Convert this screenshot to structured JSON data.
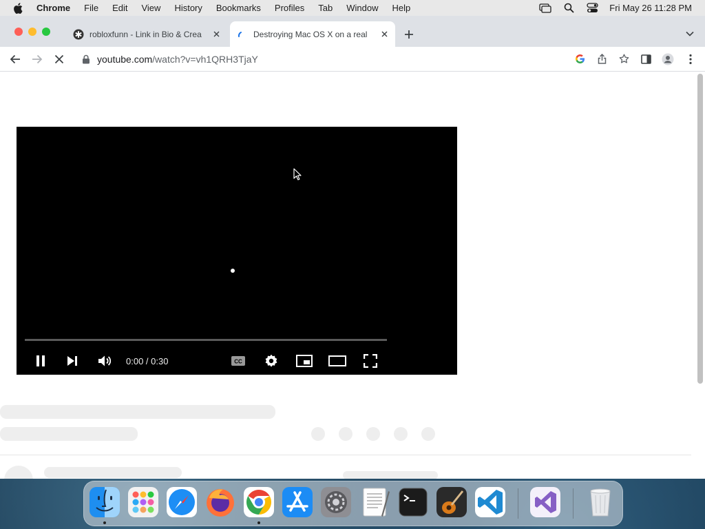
{
  "menubar": {
    "app_name": "Chrome",
    "items": [
      "File",
      "Edit",
      "View",
      "History",
      "Bookmarks",
      "Profiles",
      "Tab",
      "Window",
      "Help"
    ],
    "clock": "Fri May 26  11:28 PM",
    "status_icons": [
      "screen-mirroring-icon",
      "spotlight-search-icon",
      "control-center-icon"
    ]
  },
  "tabs": [
    {
      "title": "robloxfunn - Link in Bio & Crea",
      "favicon": "linktree-icon",
      "active": false
    },
    {
      "title": "Destroying Mac OS X on a real",
      "favicon": "loading-spinner-icon",
      "active": true
    }
  ],
  "toolbar": {
    "url_host": "youtube.com",
    "url_path": "/watch?v=vh1QRH3TjaY"
  },
  "player": {
    "time": "0:00 / 0:30",
    "progress": 0.0,
    "state": "playing"
  },
  "dock": {
    "apps": [
      "Finder",
      "Launchpad",
      "Safari",
      "Firefox",
      "Google Chrome",
      "App Store",
      "System Preferences",
      "TextEdit",
      "Terminal",
      "GarageBand",
      "Visual Studio Code",
      "Visual Studio",
      "Trash"
    ],
    "running": [
      "Finder",
      "Google Chrome"
    ]
  },
  "colors": {
    "menubar_bg": "#e8e8e8",
    "tabstrip_bg": "#dee1e6",
    "player_bg": "#000000",
    "skeleton": "#eeeeee"
  }
}
